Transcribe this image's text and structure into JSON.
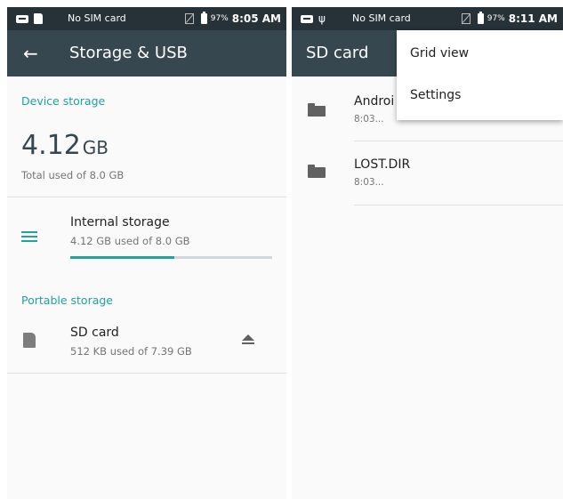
{
  "left": {
    "status": {
      "carrier": "No SIM card",
      "battery": "97%",
      "time": "8:05 AM"
    },
    "appbar": {
      "title": "Storage & USB"
    },
    "device_storage": {
      "header": "Device storage",
      "used_number": "4.12",
      "used_unit": "GB",
      "caption": "Total used of 8.0 GB"
    },
    "internal": {
      "title": "Internal storage",
      "subtitle": "4.12 GB used of 8.0 GB",
      "progress": 0.515
    },
    "portable": {
      "header": "Portable storage",
      "title": "SD card",
      "subtitle": "512 KB used of 7.39 GB"
    }
  },
  "right": {
    "status": {
      "carrier": "No SIM card",
      "battery": "97%",
      "time": "8:11 AM"
    },
    "appbar": {
      "title": "SD card"
    },
    "folders": [
      {
        "name": "Androi",
        "date": "8:03..."
      },
      {
        "name": "LOST.DIR",
        "date": "8:03..."
      }
    ],
    "menu": {
      "items": [
        "Grid view",
        "Settings"
      ]
    }
  },
  "colors": {
    "status_bar": "#263238",
    "app_bar": "#37474f",
    "accent": "#1fa39a"
  }
}
